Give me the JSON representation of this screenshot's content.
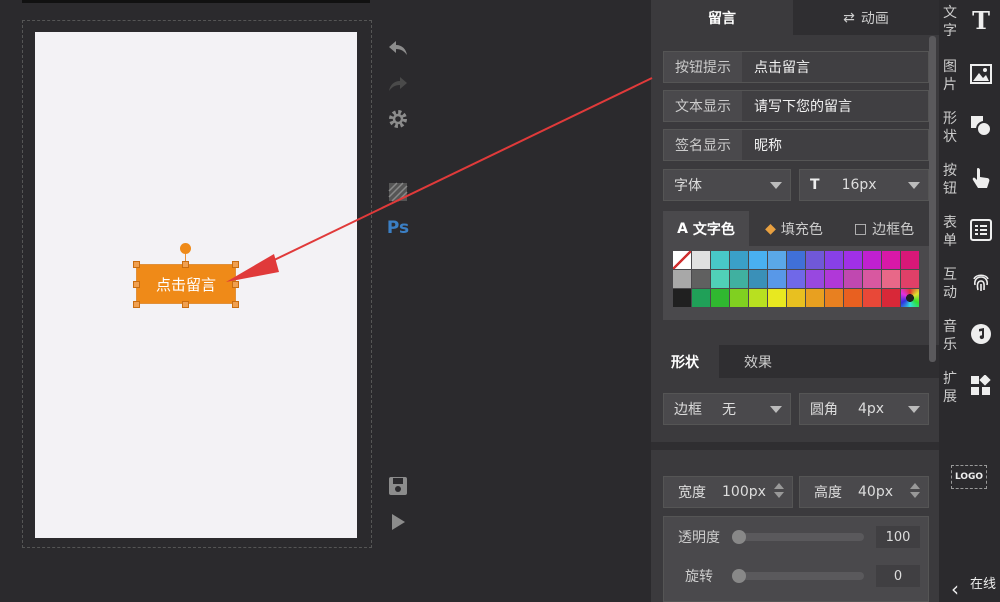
{
  "canvas": {
    "button_label": "点击留言"
  },
  "panel": {
    "tabs": [
      {
        "label": "留言"
      },
      {
        "label": "动画"
      }
    ],
    "fields": [
      {
        "label": "按钮提示",
        "value": "点击留言"
      },
      {
        "label": "文本显示",
        "value": "请写下您的留言"
      },
      {
        "label": "签名显示",
        "value": "昵称"
      }
    ],
    "font_select": "字体",
    "font_size": "16px",
    "color_tabs": [
      {
        "label": "文字色"
      },
      {
        "label": "填充色"
      },
      {
        "label": "边框色"
      }
    ],
    "palette_colors": [
      [
        "#ffffff",
        "#e0e0e0",
        "#48c8c8",
        "#3aa0c8",
        "#49b0f0",
        "#5aa8e8",
        "#4070d8",
        "#7058d8",
        "#8840e8",
        "#a030e8",
        "#c020d0",
        "#d818a8",
        "#d81878"
      ],
      [
        "#a8a8a8",
        "#606060",
        "#50d0b8",
        "#40b0a0",
        "#3a90b8",
        "#5898e8",
        "#7068e8",
        "#9848e0",
        "#b038d8",
        "#c048b0",
        "#d858a0",
        "#e86888",
        "#e04068"
      ],
      [
        "#202020",
        "#20a058",
        "#30b830",
        "#80d020",
        "#b8e020",
        "#e8e820",
        "#e8c020",
        "#e8a020",
        "#e88020",
        "#e86020",
        "#e84838",
        "#d82838",
        "#202020"
      ]
    ],
    "shape_tabs": [
      {
        "label": "形状"
      },
      {
        "label": "效果"
      }
    ],
    "border_label": "边框",
    "border_value": "无",
    "radius_label": "圆角",
    "radius_value": "4px",
    "width_label": "宽度",
    "width_value": "100px",
    "height_label": "高度",
    "height_value": "40px",
    "opacity_label": "透明度",
    "opacity_value": "100",
    "rotate_label": "旋转",
    "rotate_value": "0"
  },
  "sidebar": {
    "items": [
      {
        "label": "文字",
        "icon": "T"
      },
      {
        "label": "图片",
        "icon": "🖼"
      },
      {
        "label": "形状",
        "icon": "◐"
      },
      {
        "label": "按钮",
        "icon": "☝"
      },
      {
        "label": "表单",
        "icon": "☰"
      },
      {
        "label": "互动",
        "icon": "◎"
      },
      {
        "label": "音乐",
        "icon": "♪"
      },
      {
        "label": "扩展",
        "icon": "▦"
      }
    ],
    "logo": "LOGO",
    "online": "在线"
  },
  "colors": {
    "accent": "#ef8a18",
    "arrow": "#e03a3a"
  }
}
